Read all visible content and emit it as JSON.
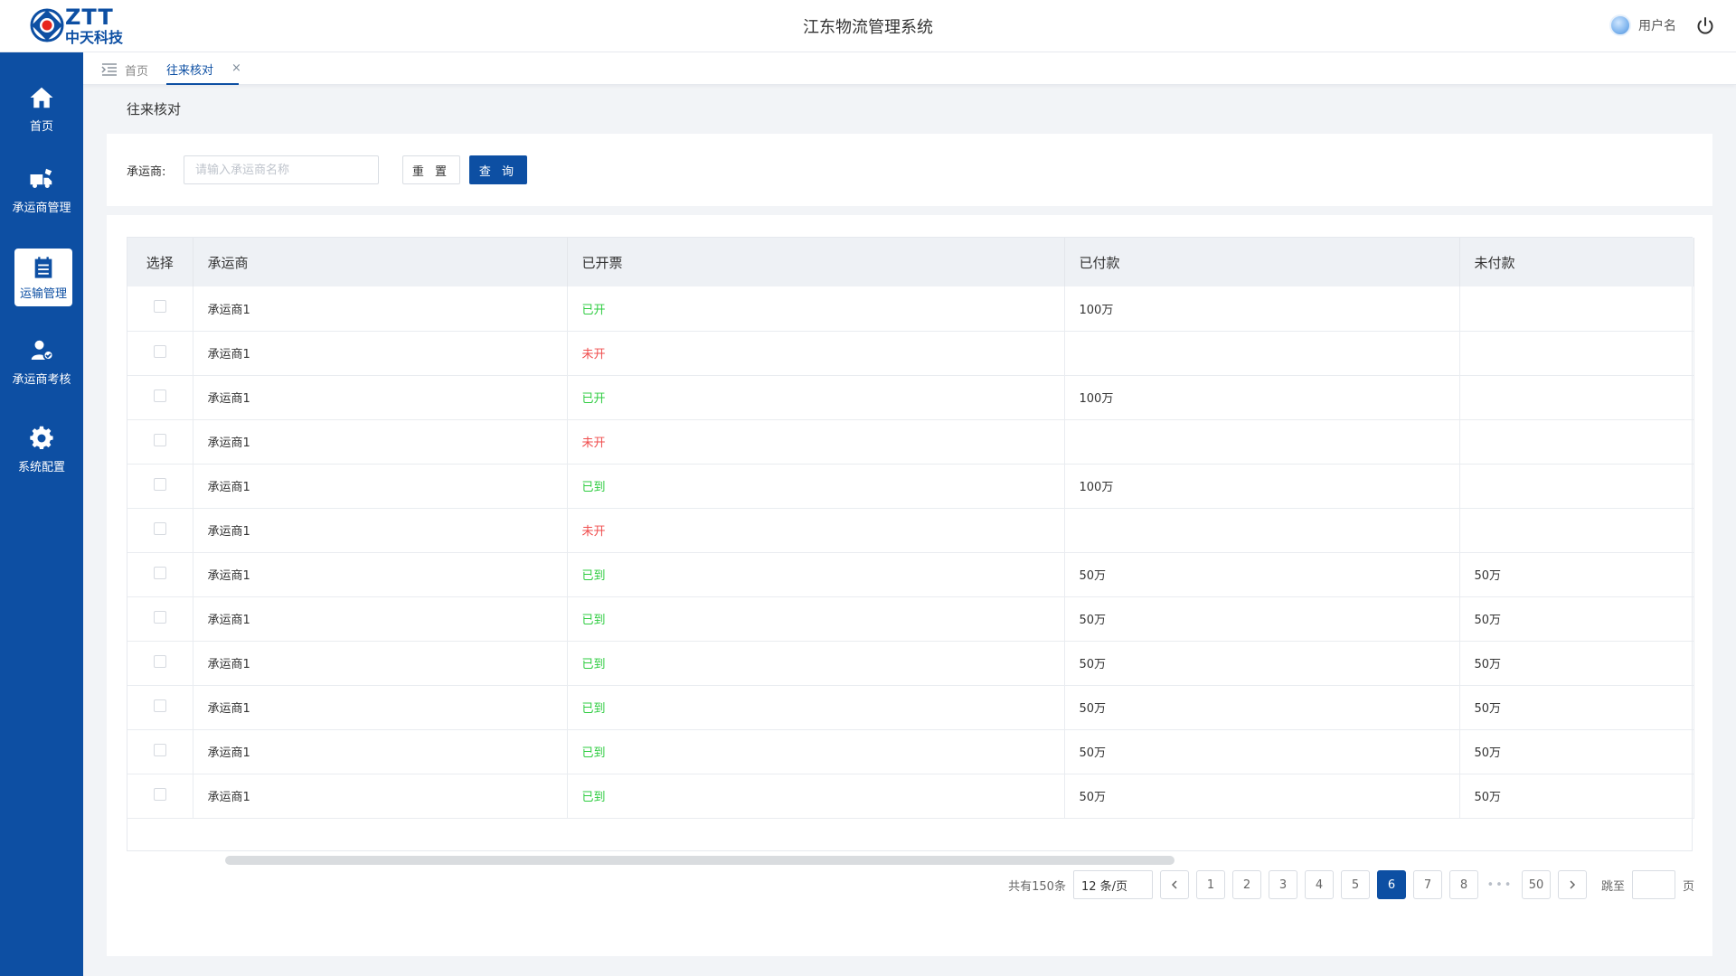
{
  "header": {
    "logo_text": "ZTT",
    "logo_cn": "中天科技",
    "title": "江东物流管理系统",
    "username": "用户名"
  },
  "sidebar": {
    "items": [
      {
        "label": "首页",
        "icon": "home-icon"
      },
      {
        "label": "承运商管理",
        "icon": "truck-icon"
      },
      {
        "label": "运输管理",
        "icon": "clipboard-list-icon",
        "active": true
      },
      {
        "label": "承运商考核",
        "icon": "user-check-icon"
      },
      {
        "label": "系统配置",
        "icon": "gear-icon"
      }
    ]
  },
  "tabs": {
    "home": "首页",
    "active": "往来核对",
    "close": "×"
  },
  "page": {
    "title": "往来核对"
  },
  "filter": {
    "label": "承运商:",
    "placeholder": "请输入承运商名称",
    "reset": "重 置",
    "query": "查 询"
  },
  "table": {
    "columns": [
      "选择",
      "承运商",
      "已开票",
      "已付款",
      "未付款"
    ],
    "rows": [
      {
        "carrier": "承运商1",
        "invoice": "已开",
        "status": "green",
        "paid": "100万",
        "unpaid": ""
      },
      {
        "carrier": "承运商1",
        "invoice": "未开",
        "status": "red",
        "paid": "",
        "unpaid": ""
      },
      {
        "carrier": "承运商1",
        "invoice": "已开",
        "status": "green",
        "paid": "100万",
        "unpaid": ""
      },
      {
        "carrier": "承运商1",
        "invoice": "未开",
        "status": "red",
        "paid": "",
        "unpaid": ""
      },
      {
        "carrier": "承运商1",
        "invoice": "已到",
        "status": "green",
        "paid": "100万",
        "unpaid": ""
      },
      {
        "carrier": "承运商1",
        "invoice": "未开",
        "status": "red",
        "paid": "",
        "unpaid": ""
      },
      {
        "carrier": "承运商1",
        "invoice": "已到",
        "status": "green",
        "paid": "50万",
        "unpaid": "50万"
      },
      {
        "carrier": "承运商1",
        "invoice": "已到",
        "status": "green",
        "paid": "50万",
        "unpaid": "50万"
      },
      {
        "carrier": "承运商1",
        "invoice": "已到",
        "status": "green",
        "paid": "50万",
        "unpaid": "50万"
      },
      {
        "carrier": "承运商1",
        "invoice": "已到",
        "status": "green",
        "paid": "50万",
        "unpaid": "50万"
      },
      {
        "carrier": "承运商1",
        "invoice": "已到",
        "status": "green",
        "paid": "50万",
        "unpaid": "50万"
      },
      {
        "carrier": "承运商1",
        "invoice": "已到",
        "status": "green",
        "paid": "50万",
        "unpaid": "50万"
      }
    ]
  },
  "pagination": {
    "total": "共有150条",
    "page_size": "12 条/页",
    "pages": [
      "1",
      "2",
      "3",
      "4",
      "5",
      "6",
      "7",
      "8"
    ],
    "current": "6",
    "ellipsis": "•••",
    "last": "50",
    "jump_label": "跳至",
    "page_unit": "页"
  },
  "colors": {
    "brand": "#0d4fa3",
    "status_green": "#2ecc40",
    "status_red": "#f04d4d"
  }
}
